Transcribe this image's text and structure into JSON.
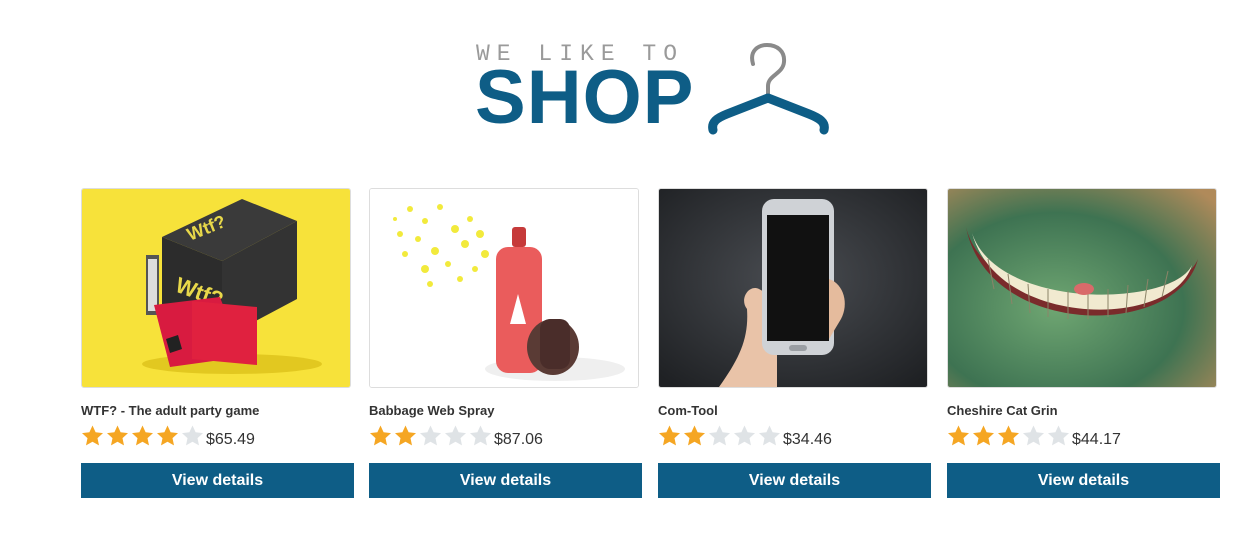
{
  "logo": {
    "small_text": "WE LIKE TO",
    "big_text": "SHOP"
  },
  "colors": {
    "brand": "#0e5d86",
    "star_filled": "#f5a623",
    "star_empty": "#dfe3e6"
  },
  "products": [
    {
      "name": "WTF? - The adult party game",
      "rating": 4,
      "max_rating": 5,
      "price": "$65.49",
      "button": "View details"
    },
    {
      "name": "Babbage Web Spray",
      "rating": 2,
      "max_rating": 5,
      "price": "$87.06",
      "button": "View details"
    },
    {
      "name": "Com-Tool",
      "rating": 2,
      "max_rating": 5,
      "price": "$34.46",
      "button": "View details"
    },
    {
      "name": "Cheshire Cat Grin",
      "rating": 3,
      "max_rating": 5,
      "price": "$44.17",
      "button": "View details"
    }
  ]
}
